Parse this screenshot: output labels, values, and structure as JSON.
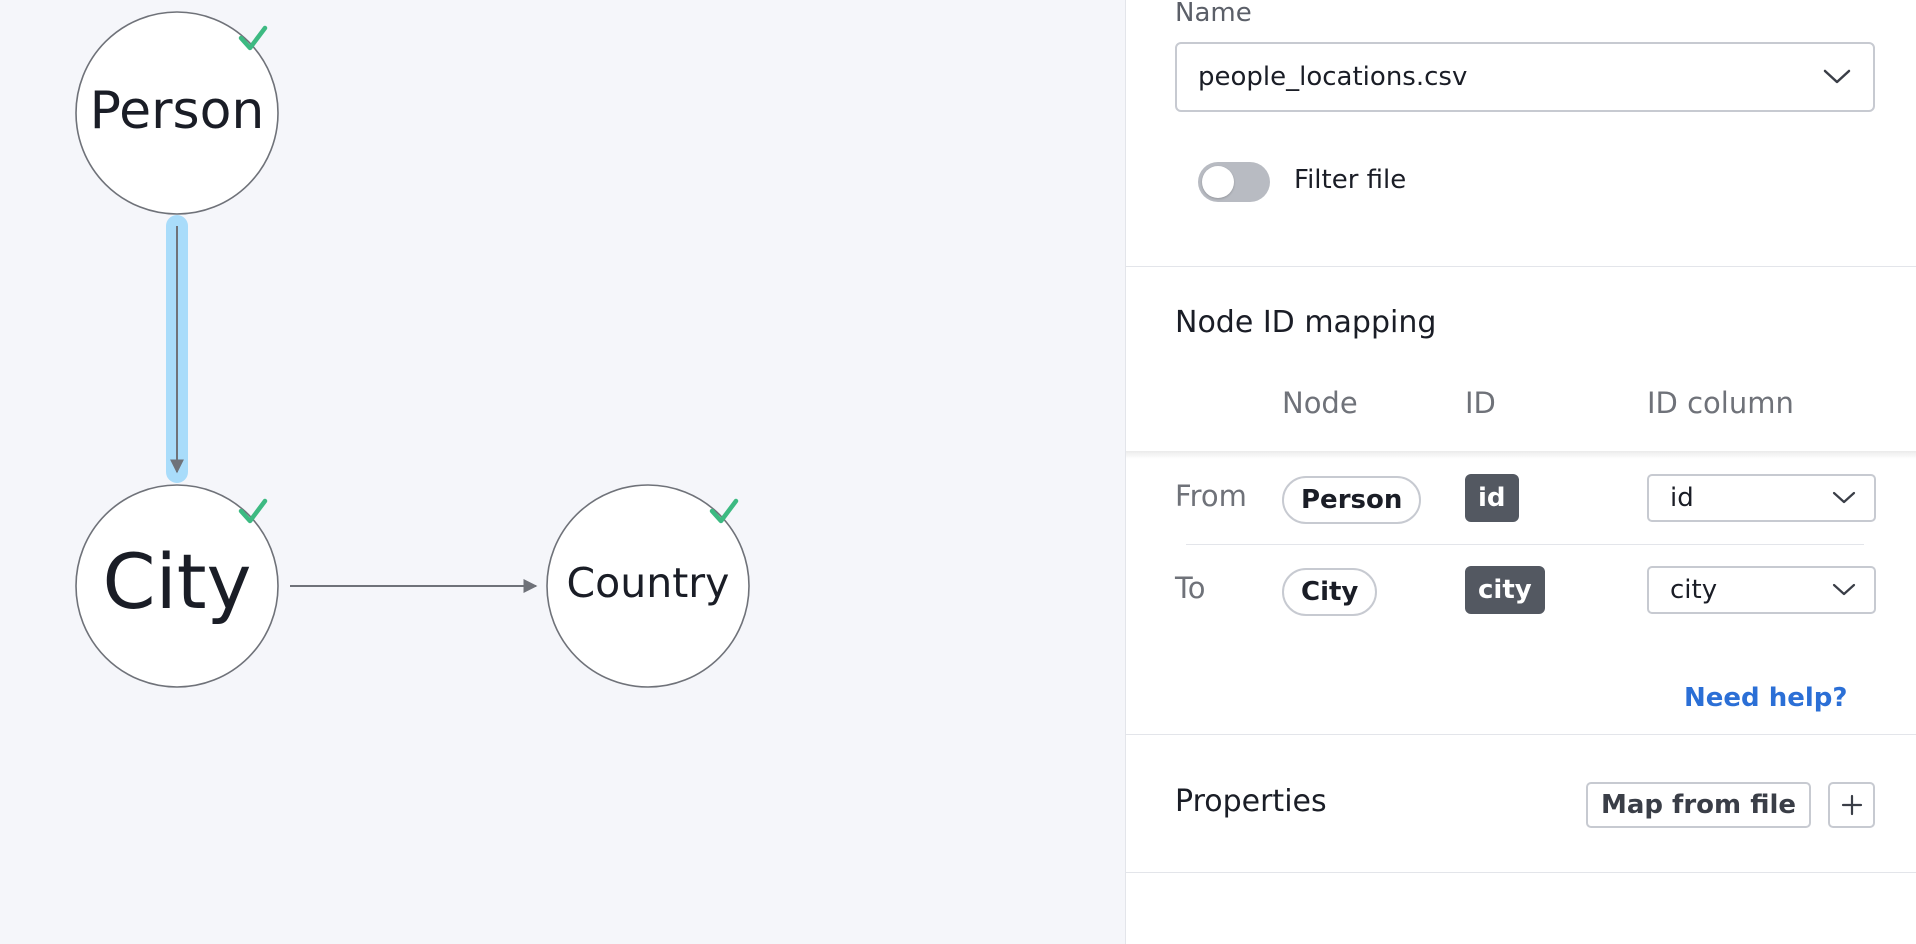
{
  "graph": {
    "nodes": [
      {
        "id": "person",
        "label": "Person",
        "status": "check-icon"
      },
      {
        "id": "city",
        "label": "City",
        "status": "check-icon"
      },
      {
        "id": "country",
        "label": "Country",
        "status": "check-icon"
      }
    ],
    "edges": [
      {
        "from": "person",
        "to": "city",
        "selected": true
      },
      {
        "from": "city",
        "to": "country",
        "selected": false
      }
    ],
    "colors": {
      "check": "#3dba82",
      "edge_highlight": "#a9dcfa"
    }
  },
  "file": {
    "name_label": "Name",
    "name_value": "people_locations.csv",
    "filter_label": "Filter file",
    "filter_enabled": false
  },
  "mapping": {
    "title": "Node ID mapping",
    "columns": {
      "node": "Node",
      "id": "ID",
      "id_column": "ID column"
    },
    "rows": [
      {
        "label": "From",
        "node": "Person",
        "id": "id",
        "id_column": "id"
      },
      {
        "label": "To",
        "node": "City",
        "id": "city",
        "id_column": "city"
      }
    ],
    "help_link": "Need help?"
  },
  "properties": {
    "title": "Properties",
    "map_button": "Map from file",
    "add_button_icon": "plus-icon"
  }
}
